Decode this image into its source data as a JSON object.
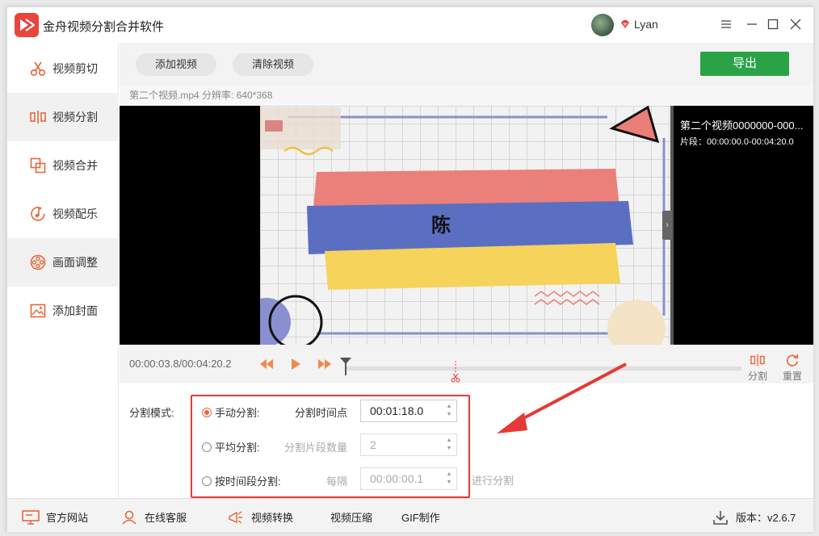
{
  "app": {
    "title": "金舟视频分割合并软件",
    "username": "Lyan",
    "accent": "#e8663a",
    "export_color": "#2aa347"
  },
  "sidebar": {
    "items": [
      {
        "label": "视频剪切",
        "icon": "scissors-icon"
      },
      {
        "label": "视频分割",
        "icon": "split-icon"
      },
      {
        "label": "视频合并",
        "icon": "merge-icon"
      },
      {
        "label": "视频配乐",
        "icon": "music-icon"
      },
      {
        "label": "画面调整",
        "icon": "film-reel-icon"
      },
      {
        "label": "添加封面",
        "icon": "image-icon"
      }
    ],
    "active_index": 1
  },
  "toolbar": {
    "add_video": "添加视频",
    "clear_video": "清除视频",
    "export": "导出"
  },
  "file_info": "第二个视频.mp4    分辨率: 640*368",
  "preview": {
    "overlay_text": "陈",
    "panel_name": "第二个视频0000000-000...",
    "panel_segment": "片段：00:00:00.0-00:04:20.0"
  },
  "timeline": {
    "timecode": "00:00:03.8/00:04:20.2",
    "split_label": "分割",
    "reset_label": "重置"
  },
  "split_mode": {
    "label": "分割模式:",
    "manual": {
      "label": "手动分割:",
      "field_label": "分割时间点",
      "value": "00:01:18.0",
      "selected": true
    },
    "average": {
      "label": "平均分割:",
      "field_label": "分割片段数量",
      "value": "2",
      "selected": false
    },
    "by_interval": {
      "label": "按时间段分割:",
      "field_label": "每隔",
      "value": "00:00:00.1",
      "selected": false
    },
    "ghost_text": "进行分割"
  },
  "statusbar": {
    "website": "官方网站",
    "support": "在线客服",
    "convert": "视频转换",
    "compress": "视频压缩",
    "gif": "GIF制作",
    "version": "版本：v2.6.7"
  }
}
